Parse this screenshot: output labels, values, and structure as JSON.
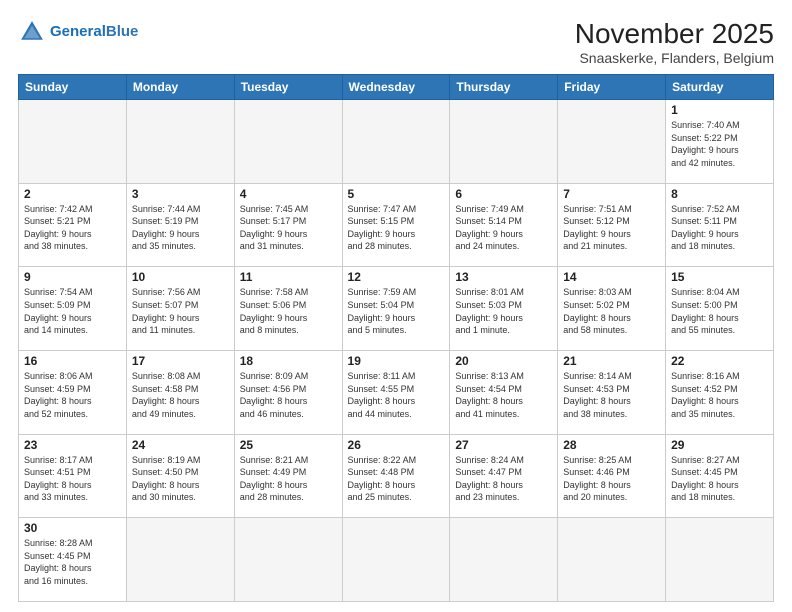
{
  "header": {
    "logo_general": "General",
    "logo_blue": "Blue",
    "month_title": "November 2025",
    "location": "Snaaskerke, Flanders, Belgium"
  },
  "weekdays": [
    "Sunday",
    "Monday",
    "Tuesday",
    "Wednesday",
    "Thursday",
    "Friday",
    "Saturday"
  ],
  "weeks": [
    [
      {
        "day": "",
        "info": "",
        "empty": true
      },
      {
        "day": "",
        "info": "",
        "empty": true
      },
      {
        "day": "",
        "info": "",
        "empty": true
      },
      {
        "day": "",
        "info": "",
        "empty": true
      },
      {
        "day": "",
        "info": "",
        "empty": true
      },
      {
        "day": "",
        "info": "",
        "empty": true
      },
      {
        "day": "1",
        "info": "Sunrise: 7:40 AM\nSunset: 5:22 PM\nDaylight: 9 hours\nand 42 minutes."
      }
    ],
    [
      {
        "day": "2",
        "info": "Sunrise: 7:42 AM\nSunset: 5:21 PM\nDaylight: 9 hours\nand 38 minutes."
      },
      {
        "day": "3",
        "info": "Sunrise: 7:44 AM\nSunset: 5:19 PM\nDaylight: 9 hours\nand 35 minutes."
      },
      {
        "day": "4",
        "info": "Sunrise: 7:45 AM\nSunset: 5:17 PM\nDaylight: 9 hours\nand 31 minutes."
      },
      {
        "day": "5",
        "info": "Sunrise: 7:47 AM\nSunset: 5:15 PM\nDaylight: 9 hours\nand 28 minutes."
      },
      {
        "day": "6",
        "info": "Sunrise: 7:49 AM\nSunset: 5:14 PM\nDaylight: 9 hours\nand 24 minutes."
      },
      {
        "day": "7",
        "info": "Sunrise: 7:51 AM\nSunset: 5:12 PM\nDaylight: 9 hours\nand 21 minutes."
      },
      {
        "day": "8",
        "info": "Sunrise: 7:52 AM\nSunset: 5:11 PM\nDaylight: 9 hours\nand 18 minutes."
      }
    ],
    [
      {
        "day": "9",
        "info": "Sunrise: 7:54 AM\nSunset: 5:09 PM\nDaylight: 9 hours\nand 14 minutes."
      },
      {
        "day": "10",
        "info": "Sunrise: 7:56 AM\nSunset: 5:07 PM\nDaylight: 9 hours\nand 11 minutes."
      },
      {
        "day": "11",
        "info": "Sunrise: 7:58 AM\nSunset: 5:06 PM\nDaylight: 9 hours\nand 8 minutes."
      },
      {
        "day": "12",
        "info": "Sunrise: 7:59 AM\nSunset: 5:04 PM\nDaylight: 9 hours\nand 5 minutes."
      },
      {
        "day": "13",
        "info": "Sunrise: 8:01 AM\nSunset: 5:03 PM\nDaylight: 9 hours\nand 1 minute."
      },
      {
        "day": "14",
        "info": "Sunrise: 8:03 AM\nSunset: 5:02 PM\nDaylight: 8 hours\nand 58 minutes."
      },
      {
        "day": "15",
        "info": "Sunrise: 8:04 AM\nSunset: 5:00 PM\nDaylight: 8 hours\nand 55 minutes."
      }
    ],
    [
      {
        "day": "16",
        "info": "Sunrise: 8:06 AM\nSunset: 4:59 PM\nDaylight: 8 hours\nand 52 minutes."
      },
      {
        "day": "17",
        "info": "Sunrise: 8:08 AM\nSunset: 4:58 PM\nDaylight: 8 hours\nand 49 minutes."
      },
      {
        "day": "18",
        "info": "Sunrise: 8:09 AM\nSunset: 4:56 PM\nDaylight: 8 hours\nand 46 minutes."
      },
      {
        "day": "19",
        "info": "Sunrise: 8:11 AM\nSunset: 4:55 PM\nDaylight: 8 hours\nand 44 minutes."
      },
      {
        "day": "20",
        "info": "Sunrise: 8:13 AM\nSunset: 4:54 PM\nDaylight: 8 hours\nand 41 minutes."
      },
      {
        "day": "21",
        "info": "Sunrise: 8:14 AM\nSunset: 4:53 PM\nDaylight: 8 hours\nand 38 minutes."
      },
      {
        "day": "22",
        "info": "Sunrise: 8:16 AM\nSunset: 4:52 PM\nDaylight: 8 hours\nand 35 minutes."
      }
    ],
    [
      {
        "day": "23",
        "info": "Sunrise: 8:17 AM\nSunset: 4:51 PM\nDaylight: 8 hours\nand 33 minutes."
      },
      {
        "day": "24",
        "info": "Sunrise: 8:19 AM\nSunset: 4:50 PM\nDaylight: 8 hours\nand 30 minutes."
      },
      {
        "day": "25",
        "info": "Sunrise: 8:21 AM\nSunset: 4:49 PM\nDaylight: 8 hours\nand 28 minutes."
      },
      {
        "day": "26",
        "info": "Sunrise: 8:22 AM\nSunset: 4:48 PM\nDaylight: 8 hours\nand 25 minutes."
      },
      {
        "day": "27",
        "info": "Sunrise: 8:24 AM\nSunset: 4:47 PM\nDaylight: 8 hours\nand 23 minutes."
      },
      {
        "day": "28",
        "info": "Sunrise: 8:25 AM\nSunset: 4:46 PM\nDaylight: 8 hours\nand 20 minutes."
      },
      {
        "day": "29",
        "info": "Sunrise: 8:27 AM\nSunset: 4:45 PM\nDaylight: 8 hours\nand 18 minutes."
      }
    ],
    [
      {
        "day": "30",
        "info": "Sunrise: 8:28 AM\nSunset: 4:45 PM\nDaylight: 8 hours\nand 16 minutes.",
        "last": true
      },
      {
        "day": "",
        "info": "",
        "empty": true,
        "last": true
      },
      {
        "day": "",
        "info": "",
        "empty": true,
        "last": true
      },
      {
        "day": "",
        "info": "",
        "empty": true,
        "last": true
      },
      {
        "day": "",
        "info": "",
        "empty": true,
        "last": true
      },
      {
        "day": "",
        "info": "",
        "empty": true,
        "last": true
      },
      {
        "day": "",
        "info": "",
        "empty": true,
        "last": true
      }
    ]
  ]
}
